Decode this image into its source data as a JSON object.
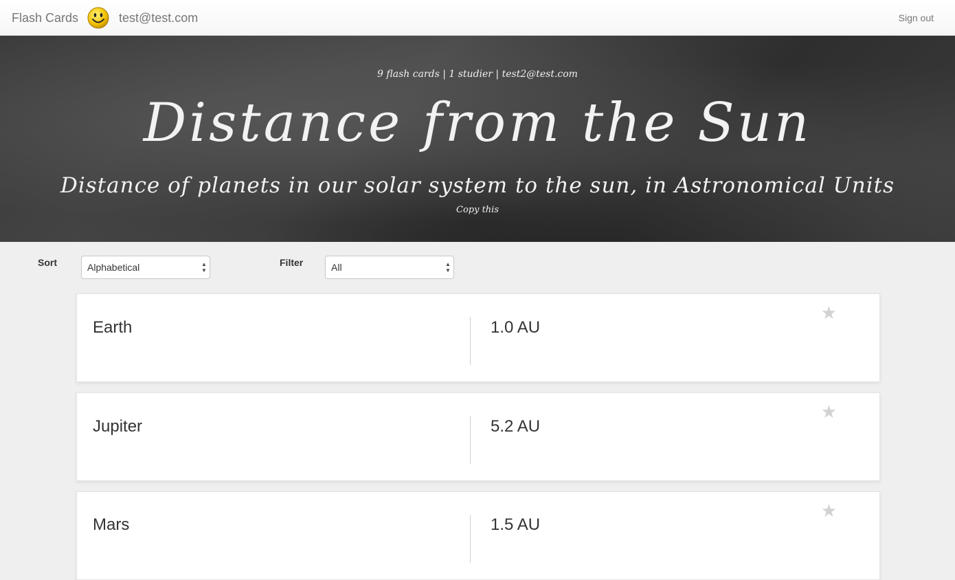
{
  "nav": {
    "brand": "Flash Cards",
    "user_email": "test@test.com",
    "sign_out": "Sign out"
  },
  "hero": {
    "meta": "9 flash cards | 1 studier | test2@test.com",
    "title": "Distance from the Sun",
    "subtitle": "Distance of planets in our solar system to the sun, in Astronomical Units",
    "copy_link": "Copy this"
  },
  "controls": {
    "sort_label": "Sort",
    "sort_value": "Alphabetical",
    "filter_label": "Filter",
    "filter_value": "All"
  },
  "cards": [
    {
      "front": "Earth",
      "back": "1.0 AU",
      "star": "★"
    },
    {
      "front": "Jupiter",
      "back": "5.2 AU",
      "star": "★"
    },
    {
      "front": "Mars",
      "back": "1.5 AU",
      "star": "★"
    }
  ],
  "icons": {
    "avatar": "smiley-face-icon",
    "star": "star-icon",
    "select_arrows": "select-arrows-icon"
  }
}
